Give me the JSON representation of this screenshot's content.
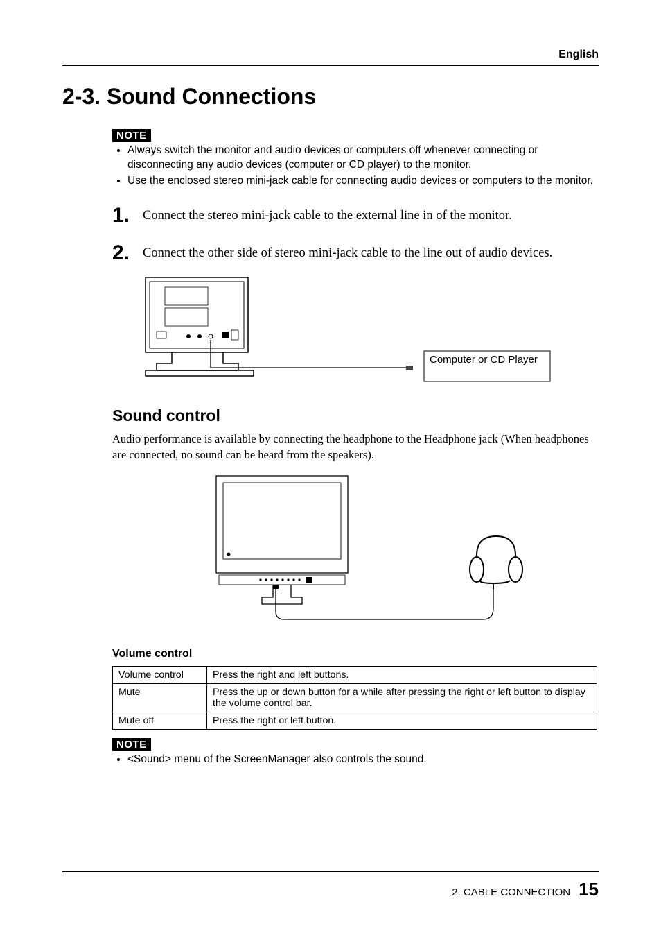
{
  "header": {
    "lang": "English"
  },
  "title": "2-3. Sound Connections",
  "note_label": "NOTE",
  "note1": {
    "items": [
      "Always switch the monitor and audio devices or computers off whenever connecting or disconnecting any audio devices (computer or CD player) to the monitor.",
      "Use the enclosed stereo mini-jack cable for connecting audio devices or computers to the monitor."
    ]
  },
  "steps": [
    {
      "num": "1.",
      "text": "Connect the stereo mini-jack cable to the external line in of the monitor."
    },
    {
      "num": "2.",
      "text": "Connect the other side of stereo mini-jack cable to the line out of audio devices."
    }
  ],
  "diagram1": {
    "device_label": "Computer or CD Player"
  },
  "sound_control": {
    "heading": "Sound control",
    "body": "Audio performance is available by connecting the headphone to the Headphone jack (When headphones are connected, no sound can be heard from the speakers)."
  },
  "volume_control": {
    "heading": "Volume control",
    "rows": [
      {
        "label": "Volume control",
        "desc": "Press the right and left buttons."
      },
      {
        "label": "Mute",
        "desc": "Press the up or down button for a while after pressing the right or left button to display the volume control bar."
      },
      {
        "label": "Mute off",
        "desc": "Press the right or left button."
      }
    ]
  },
  "note2": {
    "items": [
      "<Sound> menu of the ScreenManager also controls the sound."
    ]
  },
  "footer": {
    "chapter": "2. CABLE CONNECTION",
    "page": "15"
  }
}
